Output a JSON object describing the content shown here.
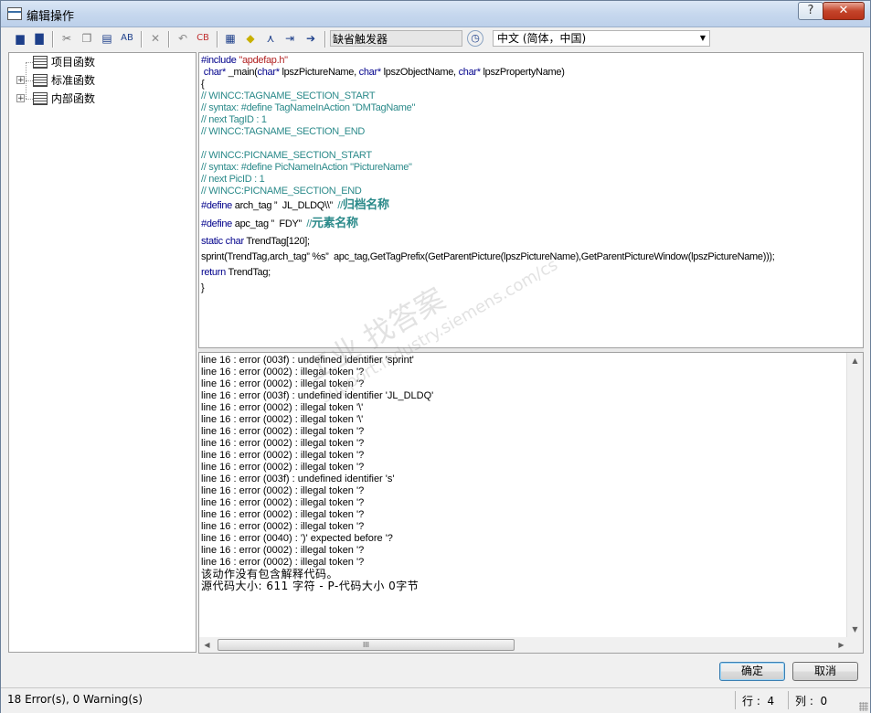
{
  "window": {
    "title": "编辑操作",
    "help_label": "?",
    "close_label": "✕"
  },
  "toolbar": {
    "trigger_label": "缺省触发器",
    "language": "中文 (简体，中国)",
    "icons": [
      "save-icon",
      "save-all-icon",
      "cut-icon",
      "copy-icon",
      "paste-icon",
      "replace-icon",
      "delete-icon",
      "undo-icon",
      "compile-icon",
      "tags-icon",
      "object-icon",
      "function-icon",
      "import-icon",
      "export-icon",
      "trigger-icon",
      "timer-icon"
    ]
  },
  "tree": {
    "items": [
      {
        "label": "项目函数",
        "expandable": false
      },
      {
        "label": "标准函数",
        "expandable": true
      },
      {
        "label": "内部函数",
        "expandable": true
      }
    ]
  },
  "code": {
    "lines": [
      [
        [
          "kw",
          "#include "
        ],
        [
          "str",
          "\"apdefap.h\""
        ]
      ],
      [
        [
          "kw",
          " char* "
        ],
        [
          "tx",
          "_main("
        ],
        [
          "kw",
          "char* "
        ],
        [
          "tx",
          "lpszPictureName, "
        ],
        [
          "kw",
          "char* "
        ],
        [
          "tx",
          "lpszObjectName, "
        ],
        [
          "kw",
          "char* "
        ],
        [
          "tx",
          "lpszPropertyName)"
        ]
      ],
      [
        [
          "tx",
          "{"
        ]
      ],
      [
        [
          "cm",
          "// WINCC:TAGNAME_SECTION_START"
        ]
      ],
      [
        [
          "cm",
          "// syntax: #define TagNameInAction \"DMTagName\""
        ]
      ],
      [
        [
          "cm",
          "// next TagID : 1"
        ]
      ],
      [
        [
          "cm",
          "// WINCC:TAGNAME_SECTION_END"
        ]
      ],
      [
        [
          "tx",
          ""
        ]
      ],
      [
        [
          "cm",
          "// WINCC:PICNAME_SECTION_START"
        ]
      ],
      [
        [
          "cm",
          "// syntax: #define PicNameInAction \"PictureName\""
        ]
      ],
      [
        [
          "cm",
          "// next PicID : 1"
        ]
      ],
      [
        [
          "cm",
          "// WINCC:PICNAME_SECTION_END"
        ]
      ],
      [
        [
          "kw",
          "#define "
        ],
        [
          "tx",
          "arch_tag ”  JL_DLDQ\\\\”  "
        ],
        [
          "cm",
          "//"
        ],
        [
          "cn",
          "归档名称"
        ]
      ],
      [
        [
          "kw",
          "#define "
        ],
        [
          "tx",
          "apc_tag ”  FDY”  "
        ],
        [
          "cm",
          "//"
        ],
        [
          "cn",
          "元素名称"
        ]
      ],
      [
        [
          "kw",
          "static char "
        ],
        [
          "tx",
          "TrendTag[120];"
        ]
      ],
      [
        [
          "tx",
          "sprint(TrendTag,arch_tag” %s”  apc_tag,GetTagPrefix(GetParentPicture(lpszPictureName),GetParentPictureWindow(lpszPictureName)));"
        ]
      ],
      [
        [
          "kw",
          "return "
        ],
        [
          "tx",
          "TrendTag;"
        ]
      ],
      [
        [
          "tx",
          "}"
        ]
      ]
    ]
  },
  "output": {
    "lines": [
      "line 16 : error (003f) : undefined identifier 'sprint'",
      "line 16 : error (0002) : illegal token '?",
      "line 16 : error (0002) : illegal token '?",
      "line 16 : error (003f) : undefined identifier 'JL_DLDQ'",
      "line 16 : error (0002) : illegal token '\\'",
      "line 16 : error (0002) : illegal token '\\'",
      "line 16 : error (0002) : illegal token '?",
      "line 16 : error (0002) : illegal token '?",
      "line 16 : error (0002) : illegal token '?",
      "line 16 : error (0002) : illegal token '?",
      "line 16 : error (003f) : undefined identifier 's'",
      "line 16 : error (0002) : illegal token '?",
      "line 16 : error (0002) : illegal token '?",
      "line 16 : error (0002) : illegal token '?",
      "line 16 : error (0002) : illegal token '?",
      "line 16 : error (0040) : ')' expected before '?",
      "line 16 : error (0002) : illegal token '?",
      "line 16 : error (0002) : illegal token '?"
    ],
    "notes": [
      "该动作没有包含解释代码。",
      "源代码大小: 611 字符 - P-代码大小 0字节"
    ],
    "scroll_thumb_label": "III"
  },
  "buttons": {
    "ok_label": "确定",
    "cancel_label": "取消"
  },
  "status": {
    "summary": "18 Error(s), 0 Warning(s)",
    "line_label": "行 :  4",
    "col_label": "列 :  0"
  },
  "watermark": {
    "line1": "工业  找答案",
    "line2": "support.industry.siemens.com/cs"
  }
}
